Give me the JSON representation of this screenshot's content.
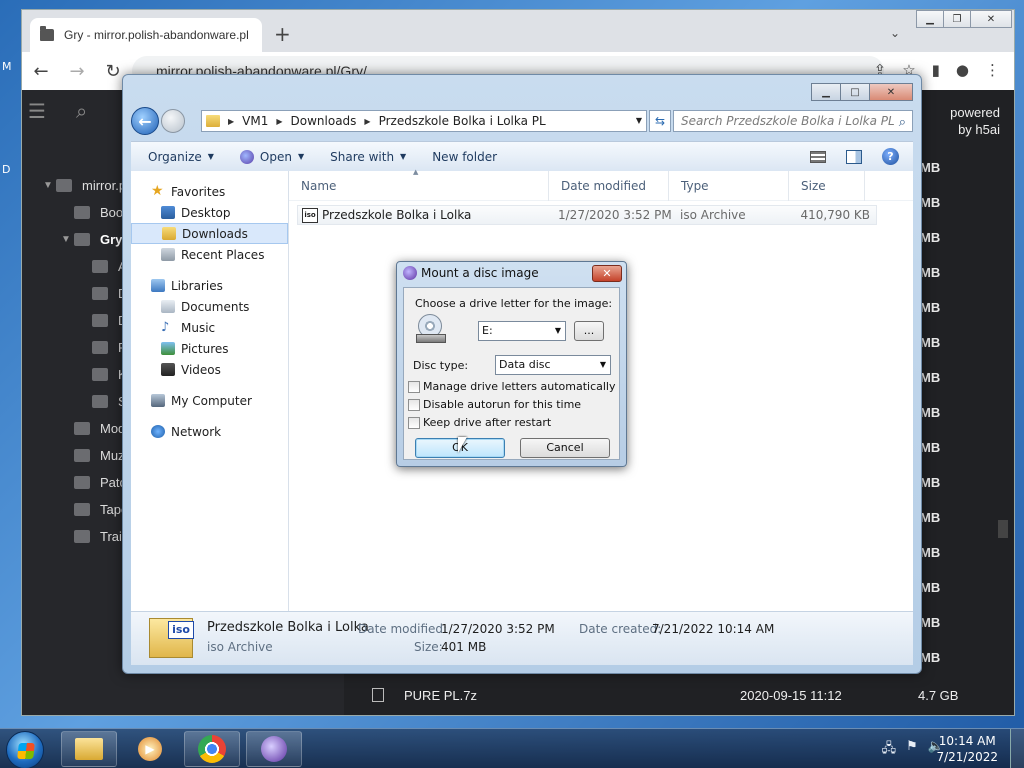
{
  "desktop": {
    "edge_m": "M",
    "edge_d": "D"
  },
  "browser": {
    "tab_title": "Gry - mirror.polish-abandonware.pl",
    "url": "mirror.polish-abandonware.pl/Gry/",
    "tree": [
      {
        "label": "mirror.p",
        "expanded": true,
        "indent": 1
      },
      {
        "label": "Boo",
        "indent": 2
      },
      {
        "label": "Gry",
        "expanded": true,
        "indent": 2,
        "bold": true
      },
      {
        "label": "A",
        "indent": 3
      },
      {
        "label": "D",
        "indent": 3
      },
      {
        "label": "D",
        "indent": 3
      },
      {
        "label": "F",
        "indent": 3
      },
      {
        "label": "K",
        "indent": 3
      },
      {
        "label": "S",
        "indent": 3
      },
      {
        "label": "Mod",
        "indent": 2
      },
      {
        "label": "Muz",
        "indent": 2
      },
      {
        "label": "Patc",
        "indent": 2
      },
      {
        "label": "Tape",
        "indent": 2
      },
      {
        "label": "Trail",
        "indent": 2
      }
    ],
    "powered_line1": "powered",
    "powered_line2": "by h5ai",
    "size_unit": "MB",
    "size_column": [
      "MB",
      "MB",
      "MB",
      "MB",
      "MB",
      "MB",
      "MB",
      "MB",
      "MB",
      "MB",
      "MB",
      "MB",
      "MB",
      "MB",
      "MB"
    ],
    "bottom_row": {
      "name": "PURE PL.7z",
      "date": "2020-09-15 11:12",
      "size": "4.7 GB"
    }
  },
  "explorer": {
    "breadcrumb": [
      "VM1",
      "Downloads",
      "Przedszkole Bolka i Lolka PL"
    ],
    "search_placeholder": "Search Przedszkole Bolka i Lolka PL",
    "commands": {
      "organize": "Organize",
      "open": "Open",
      "share": "Share with",
      "new_folder": "New folder"
    },
    "nav": {
      "favorites": "Favorites",
      "desktop": "Desktop",
      "downloads": "Downloads",
      "recent": "Recent Places",
      "libraries": "Libraries",
      "documents": "Documents",
      "music": "Music",
      "pictures": "Pictures",
      "videos": "Videos",
      "computer": "My Computer",
      "network": "Network"
    },
    "columns": {
      "name": "Name",
      "date": "Date modified",
      "type": "Type",
      "size": "Size"
    },
    "file": {
      "name": "Przedszkole Bolka i Lolka",
      "date": "1/27/2020 3:52 PM",
      "type": "iso Archive",
      "size": "410,790 KB",
      "icon_text": "iso"
    },
    "details": {
      "name": "Przedszkole Bolka i Lolka",
      "type": "iso Archive",
      "date_modified_label": "Date modified:",
      "date_modified": "1/27/2020 3:52 PM",
      "date_created_label": "Date created:",
      "date_created": "7/21/2022 10:14 AM",
      "size_label": "Size:",
      "size": "401 MB"
    }
  },
  "dialog": {
    "title": "Mount a disc image",
    "choose_label": "Choose a drive letter for the image:",
    "drive_value": "E:",
    "browse_label": "...",
    "disc_type_label": "Disc type:",
    "disc_type_value": "Data disc",
    "checkboxes": [
      "Manage drive letters automatically",
      "Disable autorun for this time",
      "Keep drive after restart"
    ],
    "ok_label": "OK",
    "cancel_label": "Cancel"
  },
  "taskbar": {
    "time": "10:14 AM",
    "date": "7/21/2022"
  }
}
